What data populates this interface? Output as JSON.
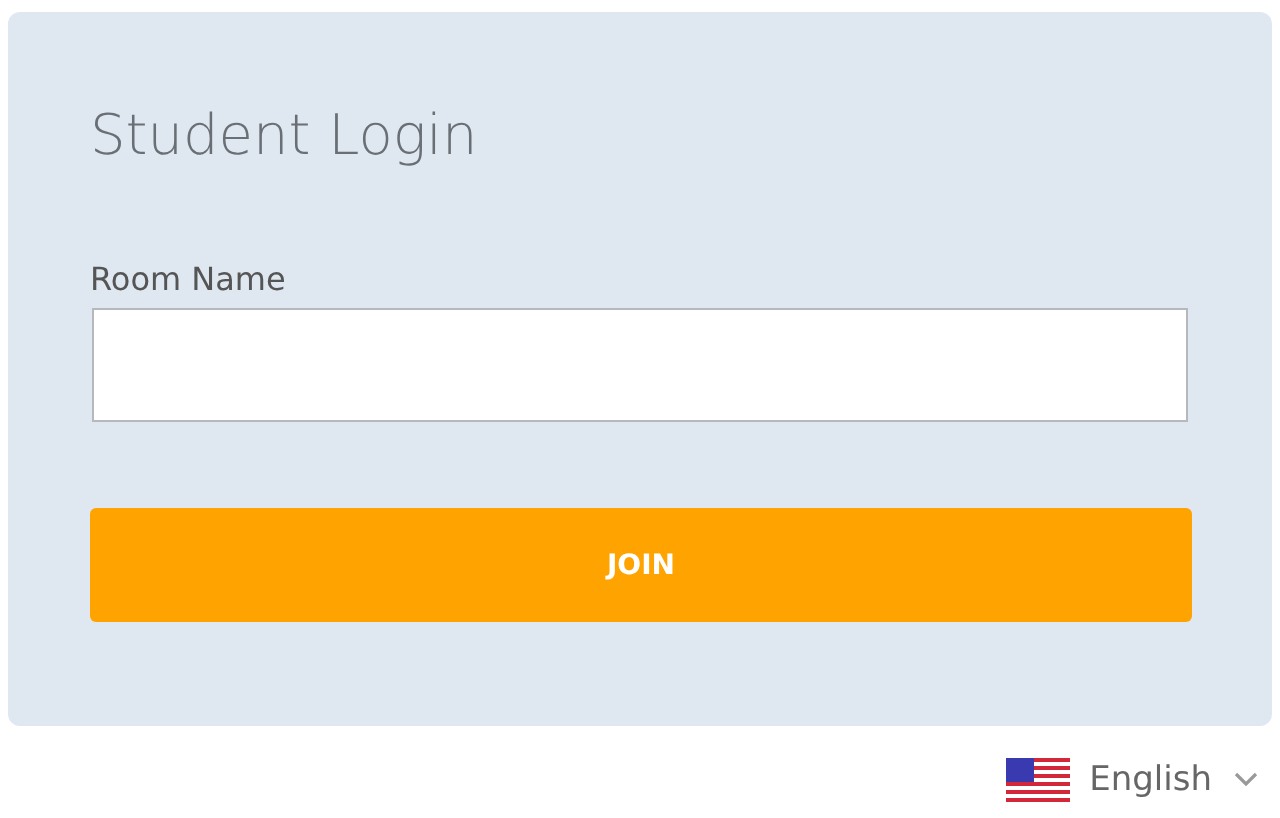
{
  "login": {
    "title": "Student Login",
    "room_field": {
      "label": "Room Name"
    },
    "join_button": "JOIN"
  },
  "language": {
    "label": "English"
  }
}
